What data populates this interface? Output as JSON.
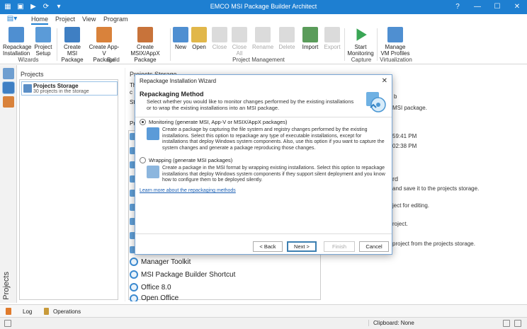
{
  "app": {
    "title": "EMCO MSI Package Builder Architect",
    "colors": {
      "accent": "#1e7fd1",
      "link": "#1a5fb4"
    }
  },
  "qat": {
    "icons": [
      "app-icon",
      "save-icon",
      "run-icon",
      "refresh-icon",
      "dropdown-icon"
    ]
  },
  "window_controls": {
    "help": "?",
    "minimize": "—",
    "maximize": "☐",
    "close": "✕"
  },
  "tabs": [
    "Home",
    "Project",
    "View",
    "Program"
  ],
  "ribbon": {
    "buttons": [
      {
        "label": "Repackage\nInstallation",
        "icon": "repackage-icon"
      },
      {
        "label": "Project\nSetup",
        "icon": "project-setup-icon"
      },
      {
        "label": "Create MSI\nPackage",
        "icon": "create-msi-icon"
      },
      {
        "label": "Create App-V\nPackage",
        "icon": "create-appv-icon"
      },
      {
        "label": "Create MSIX/AppX\nPackage",
        "icon": "create-msix-icon"
      },
      {
        "label": "New",
        "icon": "new-icon"
      },
      {
        "label": "Open",
        "icon": "open-icon"
      },
      {
        "label": "Close",
        "icon": "close-project-icon",
        "disabled": true
      },
      {
        "label": "Close\nAll",
        "icon": "close-all-icon",
        "disabled": true
      },
      {
        "label": "Rename",
        "icon": "rename-icon",
        "disabled": true
      },
      {
        "label": "Delete",
        "icon": "delete-icon",
        "disabled": true
      },
      {
        "label": "Import",
        "icon": "import-icon"
      },
      {
        "label": "Export",
        "icon": "export-icon",
        "disabled": true
      },
      {
        "label": "Start\nMonitoring",
        "icon": "start-monitoring-icon"
      },
      {
        "label": "Manage\nVM Profiles",
        "icon": "vm-profiles-icon"
      }
    ],
    "groups": [
      "Wizards",
      "Build",
      "Project Management",
      "Capture",
      "Virtualization"
    ]
  },
  "left_strip": {
    "label": "Projects",
    "icons": [
      "home-icon",
      "projects-icon",
      "packages-icon"
    ]
  },
  "projects_panel": {
    "header": "Projects",
    "item": {
      "title": "Projects Storage",
      "subtitle": "30 projects in the storage"
    }
  },
  "storage_panel": {
    "header": "Projects Storage",
    "partial_letters": [
      "Th",
      "c",
      "St",
      "Pr"
    ],
    "items": [
      "Manager Toolkit",
      "MSI Package Builder Shortcut",
      "Office 8.0",
      "Open Office"
    ]
  },
  "right_panel": {
    "texts": [
      "b",
      "MSI package.",
      "59:41 PM",
      "02:38 PM",
      "rd",
      "and save it to the projects storage.",
      "ject for editing.",
      "roject.",
      "project from the projects storage."
    ]
  },
  "bottom_tabs": [
    "Log",
    "Operations"
  ],
  "status": {
    "clipboard": "Clipboard: None"
  },
  "dialog": {
    "title": "Repackage Installation Wizard",
    "close": "✕",
    "heading": "Repackaging Method",
    "subheading": "Select whether you would like to monitor changes performed by the existing installations or to wrap the existing installations into an MSI package.",
    "options": [
      {
        "label": "Monitoring (generate MSI, App-V or MSIX/AppX packages)",
        "selected": true,
        "description": "Create a package by capturing the file system and registry changes performed by the existing installations. Select this option to repackage any type of executable installations, except for installations that deploy Windows system components. Also, use this option if you want to capture the system changes and generate a package reproducing those changes."
      },
      {
        "label": "Wrapping (generate MSI packages)",
        "selected": false,
        "description": "Create a package in the MSI format by wrapping existing installations. Select this option to repackage installations that deploy Windows system components if they support silent deployment and you know how to configure them to be deployed silently."
      }
    ],
    "link": "Learn more about the repackaging methods",
    "buttons": {
      "back": "< Back",
      "next": "Next >",
      "finish": "Finish",
      "cancel": "Cancel"
    }
  }
}
